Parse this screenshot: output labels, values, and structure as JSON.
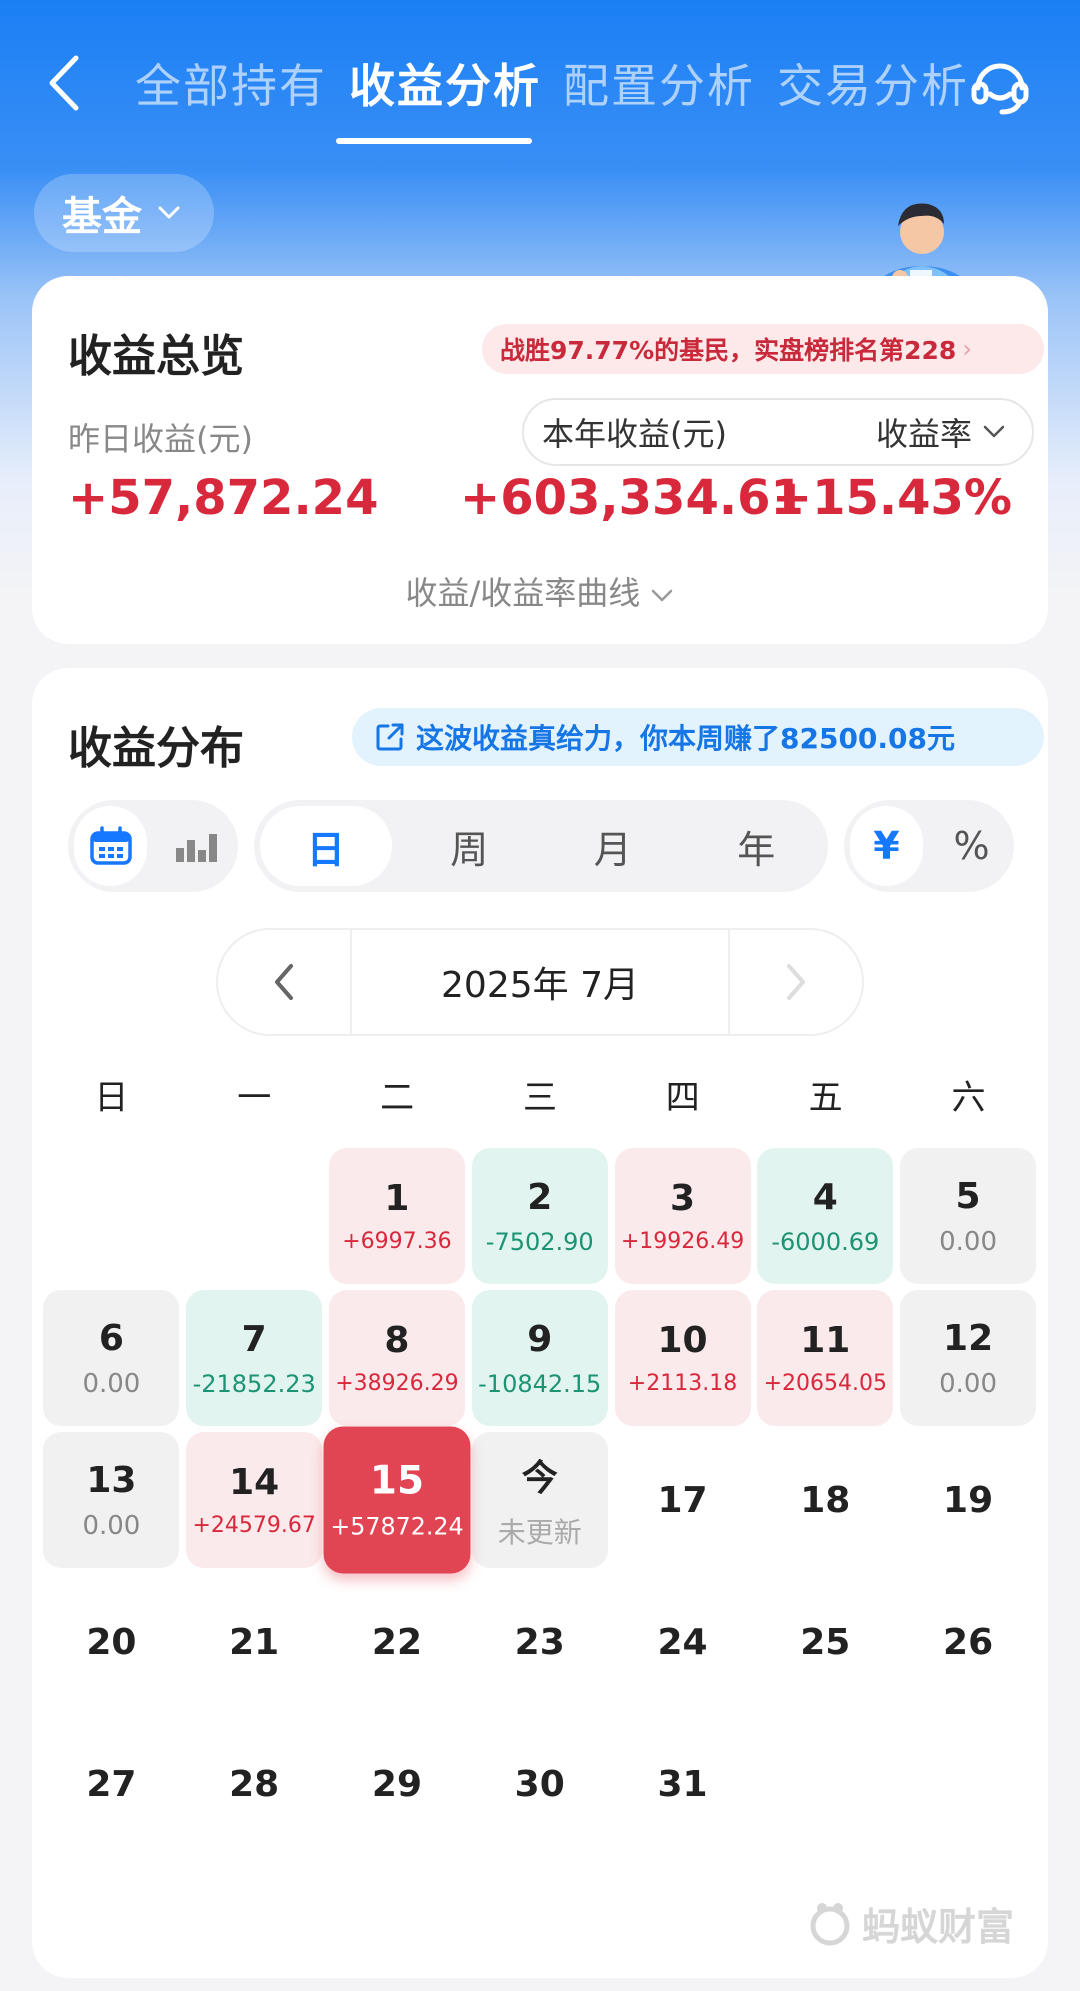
{
  "nav": {
    "tabs": [
      "全部持有",
      "收益分析",
      "配置分析",
      "交易分析"
    ],
    "active_index": 1
  },
  "filter": {
    "fund_label": "基金"
  },
  "overview": {
    "title": "收益总览",
    "rank_text": "战胜97.77%的基民，实盘榜排名第228",
    "yesterday_label": "昨日收益(元)",
    "yesterday_value": "+57,872.24",
    "year_label": "本年收益(元)",
    "rate_label": "收益率",
    "year_value": "+603,334.61",
    "rate_value": "+15.43%",
    "curve_toggle": "收益/收益率曲线"
  },
  "distribution": {
    "title": "收益分布",
    "share_text": "这波收益真给力，你本周赚了82500.08元",
    "periods": [
      "日",
      "周",
      "月",
      "年"
    ],
    "units": [
      "¥",
      "%"
    ],
    "month_label": "2025年 7月",
    "weekdays": [
      "日",
      "一",
      "二",
      "三",
      "四",
      "五",
      "六"
    ]
  },
  "calendar": {
    "weeks": [
      [
        null,
        null,
        {
          "d": "1",
          "v": "+6997.36",
          "t": "pos"
        },
        {
          "d": "2",
          "v": "-7502.90",
          "t": "neg"
        },
        {
          "d": "3",
          "v": "+19926.49",
          "t": "pos"
        },
        {
          "d": "4",
          "v": "-6000.69",
          "t": "neg"
        },
        {
          "d": "5",
          "v": "0.00",
          "t": "zero"
        }
      ],
      [
        {
          "d": "6",
          "v": "0.00",
          "t": "zero"
        },
        {
          "d": "7",
          "v": "-21852.23",
          "t": "neg"
        },
        {
          "d": "8",
          "v": "+38926.29",
          "t": "pos"
        },
        {
          "d": "9",
          "v": "-10842.15",
          "t": "neg"
        },
        {
          "d": "10",
          "v": "+2113.18",
          "t": "pos"
        },
        {
          "d": "11",
          "v": "+20654.05",
          "t": "pos"
        },
        {
          "d": "12",
          "v": "0.00",
          "t": "zero"
        }
      ],
      [
        {
          "d": "13",
          "v": "0.00",
          "t": "zero"
        },
        {
          "d": "14",
          "v": "+24579.67",
          "t": "pos"
        },
        {
          "d": "15",
          "v": "+57872.24",
          "t": "sel"
        },
        {
          "d": "今",
          "v": "未更新",
          "t": "today"
        },
        {
          "d": "17",
          "v": "",
          "t": "future"
        },
        {
          "d": "18",
          "v": "",
          "t": "future"
        },
        {
          "d": "19",
          "v": "",
          "t": "future"
        }
      ],
      [
        {
          "d": "20",
          "v": "",
          "t": "future"
        },
        {
          "d": "21",
          "v": "",
          "t": "future"
        },
        {
          "d": "22",
          "v": "",
          "t": "future"
        },
        {
          "d": "23",
          "v": "",
          "t": "future"
        },
        {
          "d": "24",
          "v": "",
          "t": "future"
        },
        {
          "d": "25",
          "v": "",
          "t": "future"
        },
        {
          "d": "26",
          "v": "",
          "t": "future"
        }
      ],
      [
        {
          "d": "27",
          "v": "",
          "t": "future"
        },
        {
          "d": "28",
          "v": "",
          "t": "future"
        },
        {
          "d": "29",
          "v": "",
          "t": "future"
        },
        {
          "d": "30",
          "v": "",
          "t": "future"
        },
        {
          "d": "31",
          "v": "",
          "t": "future"
        },
        null,
        null
      ]
    ]
  },
  "watermark": "蚂蚁财富",
  "colors": {
    "brand_blue": "#1677ff",
    "gain_red": "#d8283c",
    "loss_green": "#1c9474",
    "selected_red": "#e14452"
  },
  "icons": {
    "back": "chevron-left-icon",
    "service": "headset-icon",
    "calendar": "calendar-icon",
    "bars": "bar-chart-icon",
    "share": "share-icon"
  }
}
